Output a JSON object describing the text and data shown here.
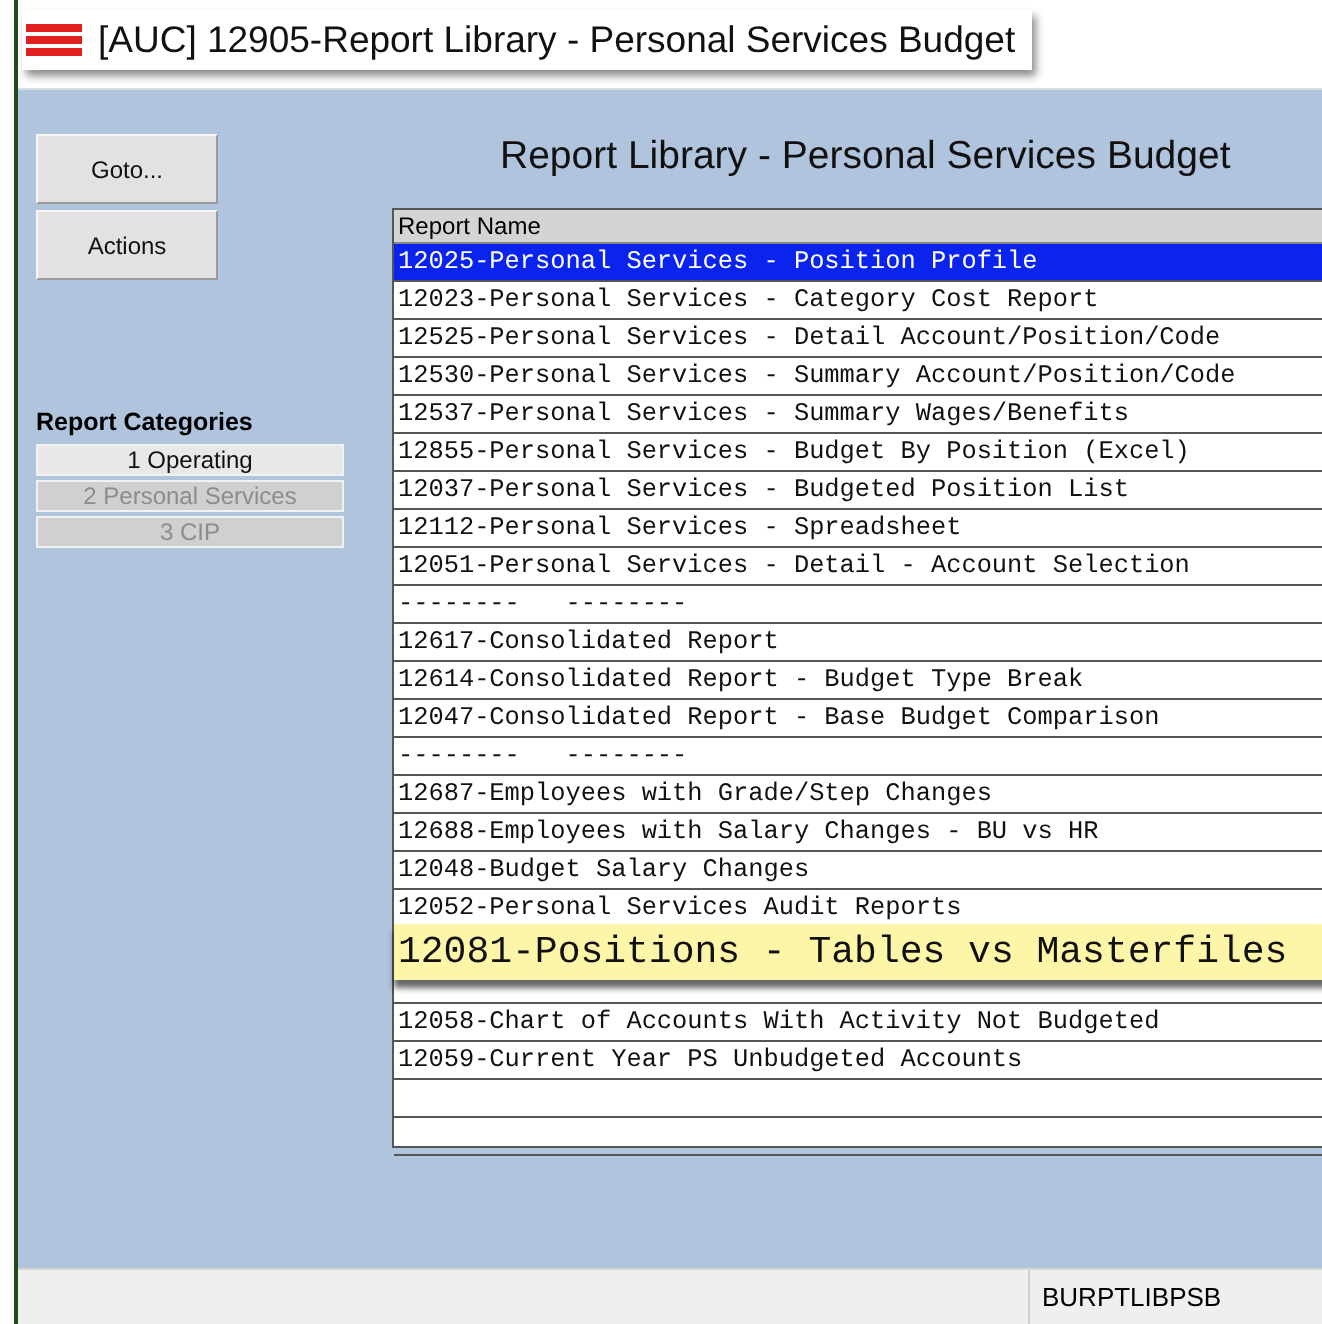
{
  "window": {
    "title": "[AUC] 12905-Report Library - Personal Services Budget"
  },
  "toolbar": {
    "buttons": [
      "Goto...",
      "Actions"
    ]
  },
  "page_title": "Report Library - Personal Services Budget",
  "categories": {
    "heading": "Report Categories",
    "items": [
      {
        "label": "1 Operating",
        "selected": true,
        "disabled": false
      },
      {
        "label": "2 Personal Services",
        "selected": false,
        "disabled": true
      },
      {
        "label": "3 CIP",
        "selected": false,
        "disabled": true
      }
    ]
  },
  "table": {
    "columns": [
      "Report Name"
    ],
    "rows": [
      {
        "kind": "report",
        "text": "12025-Personal Services - Position Profile",
        "selected": true
      },
      {
        "kind": "report",
        "text": "12023-Personal Services - Category Cost Report",
        "selected": false
      },
      {
        "kind": "report",
        "text": "12525-Personal Services - Detail Account/Position/Code",
        "selected": false
      },
      {
        "kind": "report",
        "text": "12530-Personal Services - Summary Account/Position/Code",
        "selected": false
      },
      {
        "kind": "report",
        "text": "12537-Personal Services - Summary Wages/Benefits",
        "selected": false
      },
      {
        "kind": "report",
        "text": "12855-Personal Services - Budget By Position (Excel)",
        "selected": false
      },
      {
        "kind": "report",
        "text": "12037-Personal Services - Budgeted Position List",
        "selected": false
      },
      {
        "kind": "report",
        "text": "12112-Personal Services - Spreadsheet",
        "selected": false
      },
      {
        "kind": "report",
        "text": "12051-Personal Services - Detail - Account Selection",
        "selected": false
      },
      {
        "kind": "separator",
        "text": "--------   --------",
        "selected": false
      },
      {
        "kind": "report",
        "text": "12617-Consolidated Report",
        "selected": false
      },
      {
        "kind": "report",
        "text": "12614-Consolidated Report - Budget Type Break",
        "selected": false
      },
      {
        "kind": "report",
        "text": "12047-Consolidated Report - Base Budget Comparison",
        "selected": false
      },
      {
        "kind": "separator",
        "text": "--------   --------",
        "selected": false
      },
      {
        "kind": "report",
        "text": "12687-Employees with Grade/Step Changes",
        "selected": false
      },
      {
        "kind": "report",
        "text": "12688-Employees with Salary Changes - BU vs HR",
        "selected": false
      },
      {
        "kind": "report",
        "text": "12048-Budget Salary Changes",
        "selected": false
      },
      {
        "kind": "report",
        "text": "12052-Personal Services Audit Reports",
        "selected": false
      },
      {
        "kind": "tooltip",
        "text": "12081-Positions - Tables vs Masterfiles",
        "selected": false
      },
      {
        "kind": "report",
        "text": "12058-Chart of Accounts With Activity Not Budgeted",
        "selected": false
      },
      {
        "kind": "report",
        "text": "12059-Current Year PS Unbudgeted Accounts",
        "selected": false
      },
      {
        "kind": "blank",
        "selected": false
      },
      {
        "kind": "blank",
        "selected": false
      }
    ]
  },
  "status_bar": {
    "program": "BURPTLIBPSB"
  }
}
